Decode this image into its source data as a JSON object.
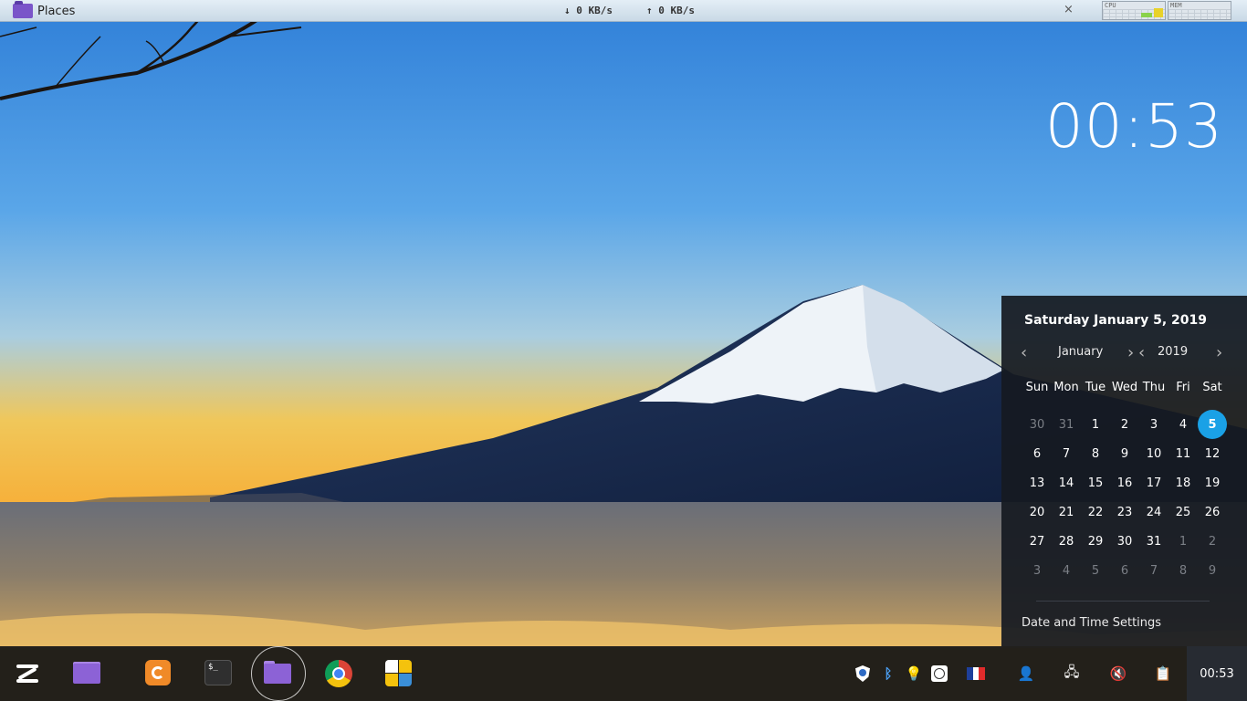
{
  "top_panel": {
    "places_label": "Places",
    "net_down": "↓  0 KB/s",
    "net_up": "↑  0 KB/s",
    "close_glyph": "×",
    "cpu_monitor_label": "CPU",
    "mem_monitor_label": "MEM"
  },
  "desktop": {
    "big_clock": "00:53"
  },
  "calendar": {
    "full_date": "Saturday January 5, 2019",
    "month": "January",
    "year": "2019",
    "prev_glyph": "‹",
    "next_glyph": "›",
    "weekdays": [
      "Sun",
      "Mon",
      "Tue",
      "Wed",
      "Thu",
      "Fri",
      "Sat"
    ],
    "days": [
      {
        "d": "30",
        "other": true
      },
      {
        "d": "31",
        "other": true
      },
      {
        "d": "1"
      },
      {
        "d": "2"
      },
      {
        "d": "3"
      },
      {
        "d": "4"
      },
      {
        "d": "5",
        "today": true
      },
      {
        "d": "6"
      },
      {
        "d": "7"
      },
      {
        "d": "8"
      },
      {
        "d": "9"
      },
      {
        "d": "10"
      },
      {
        "d": "11"
      },
      {
        "d": "12"
      },
      {
        "d": "13"
      },
      {
        "d": "14"
      },
      {
        "d": "15"
      },
      {
        "d": "16"
      },
      {
        "d": "17"
      },
      {
        "d": "18"
      },
      {
        "d": "19"
      },
      {
        "d": "20"
      },
      {
        "d": "21"
      },
      {
        "d": "22"
      },
      {
        "d": "23"
      },
      {
        "d": "24"
      },
      {
        "d": "25"
      },
      {
        "d": "26"
      },
      {
        "d": "27"
      },
      {
        "d": "28"
      },
      {
        "d": "29"
      },
      {
        "d": "30"
      },
      {
        "d": "31"
      },
      {
        "d": "1",
        "other": true
      },
      {
        "d": "2",
        "other": true
      },
      {
        "d": "3",
        "other": true
      },
      {
        "d": "4",
        "other": true
      },
      {
        "d": "5",
        "other": true
      },
      {
        "d": "6",
        "other": true
      },
      {
        "d": "7",
        "other": true
      },
      {
        "d": "8",
        "other": true
      },
      {
        "d": "9",
        "other": true
      }
    ],
    "settings_label": "Date and Time Settings",
    "today_color": "#1aa1e6"
  },
  "taskbar": {
    "apps": [
      {
        "name": "zorin-menu",
        "icon": "zorin-logo-icon"
      },
      {
        "name": "files",
        "icon": "folder-icon"
      },
      {
        "name": "firefox",
        "icon": "firefox-icon"
      },
      {
        "name": "terminal",
        "icon": "terminal-icon"
      },
      {
        "name": "files-active",
        "icon": "folder-icon"
      },
      {
        "name": "chrome",
        "icon": "chrome-icon"
      },
      {
        "name": "software",
        "icon": "software-store-icon"
      }
    ],
    "terminal_prompt": "$_",
    "tray": {
      "bluetooth_glyph": "ᛒ",
      "bulb_glyph": "💡",
      "user_glyph": "👤",
      "network_glyph": "🖧",
      "volume_glyph": "🔇",
      "clipboard_glyph": "📋"
    },
    "clock": "00:53",
    "flag_colors": [
      "#1e3f9a",
      "#ffffff",
      "#e02b2b"
    ]
  }
}
